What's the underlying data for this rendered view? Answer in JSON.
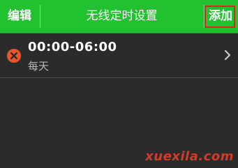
{
  "header": {
    "edit_label": "编辑",
    "title": "无线定时设置",
    "add_label": "添加"
  },
  "schedules": [
    {
      "time_range": "00:00-06:00",
      "repeat": "每天"
    }
  ],
  "icons": {
    "delete": "delete-circle-icon",
    "chevron": "chevron-right-icon"
  },
  "watermark": "xuexila.com",
  "colors": {
    "header_bg": "#21c12f",
    "background": "#2b2b2b",
    "delete_icon": "#e8552a",
    "highlight_border": "#e0231f",
    "watermark": "#d23a2a"
  }
}
